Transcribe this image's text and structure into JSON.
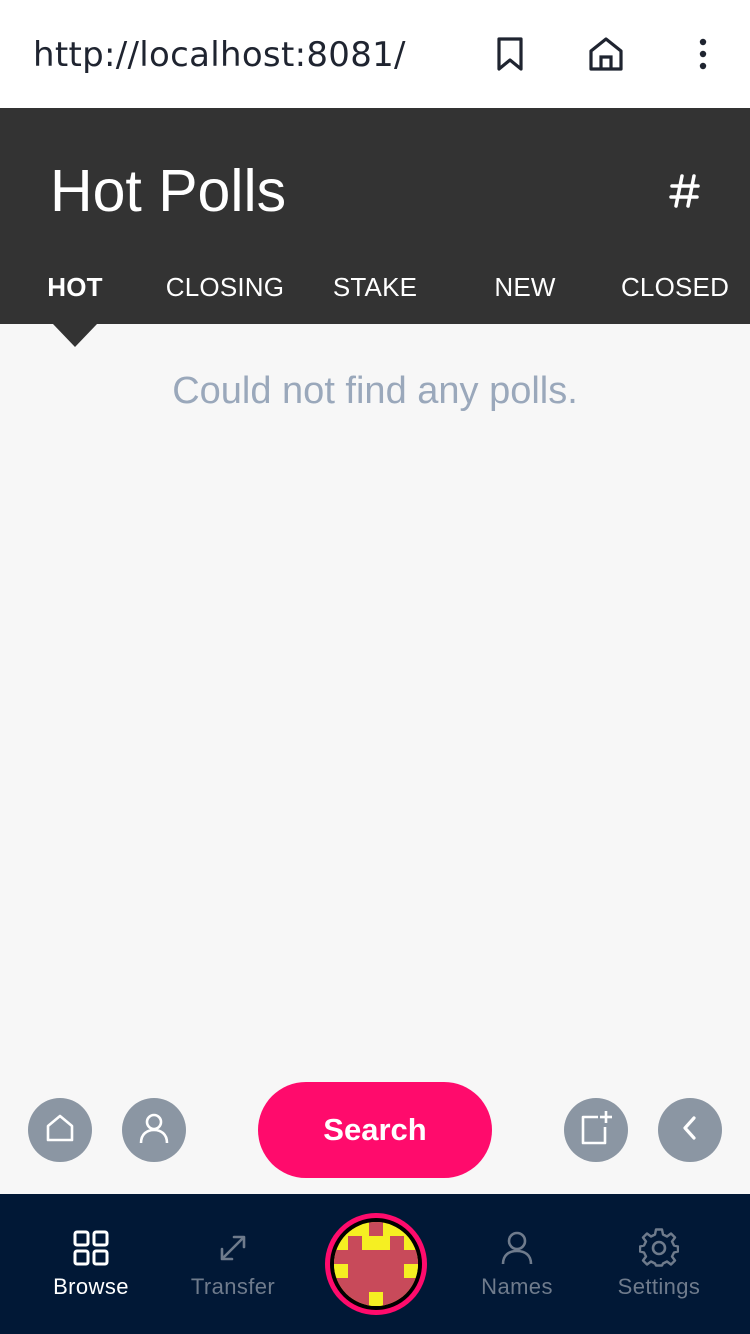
{
  "browser": {
    "url": "http://localhost:8081/",
    "icons": [
      "bookmark-icon",
      "home-icon",
      "more-vertical-icon"
    ]
  },
  "header": {
    "title": "Hot Polls",
    "action_icon": "hashtag-icon"
  },
  "tabs": [
    {
      "label": "HOT",
      "active": true
    },
    {
      "label": "CLOSING",
      "active": false
    },
    {
      "label": "STAKE",
      "active": false
    },
    {
      "label": "NEW",
      "active": false
    },
    {
      "label": "CLOSED",
      "active": false
    }
  ],
  "main": {
    "empty_message": "Could not find any polls."
  },
  "floating": {
    "search_label": "Search",
    "left_icons": [
      "home-icon",
      "user-icon"
    ],
    "right_icons": [
      "new-post-icon",
      "chevron-left-icon"
    ]
  },
  "bottom_nav": {
    "items": [
      {
        "label": "Browse",
        "icon": "grid-icon",
        "active": true
      },
      {
        "label": "Transfer",
        "icon": "expand-arrows-icon",
        "active": false
      },
      {
        "label": "",
        "icon": "identicon-avatar",
        "active": false
      },
      {
        "label": "Names",
        "icon": "user-icon",
        "active": false
      },
      {
        "label": "Settings",
        "icon": "gear-icon",
        "active": false
      }
    ]
  },
  "colors": {
    "header_bg": "#333333",
    "accent": "#ff0b6c",
    "nav_bg": "#011836",
    "fab_bg": "#8b96a3",
    "empty_text": "#9aa8bb",
    "avatar_yellow": "#f5ef22",
    "avatar_red": "#c84a5a"
  }
}
